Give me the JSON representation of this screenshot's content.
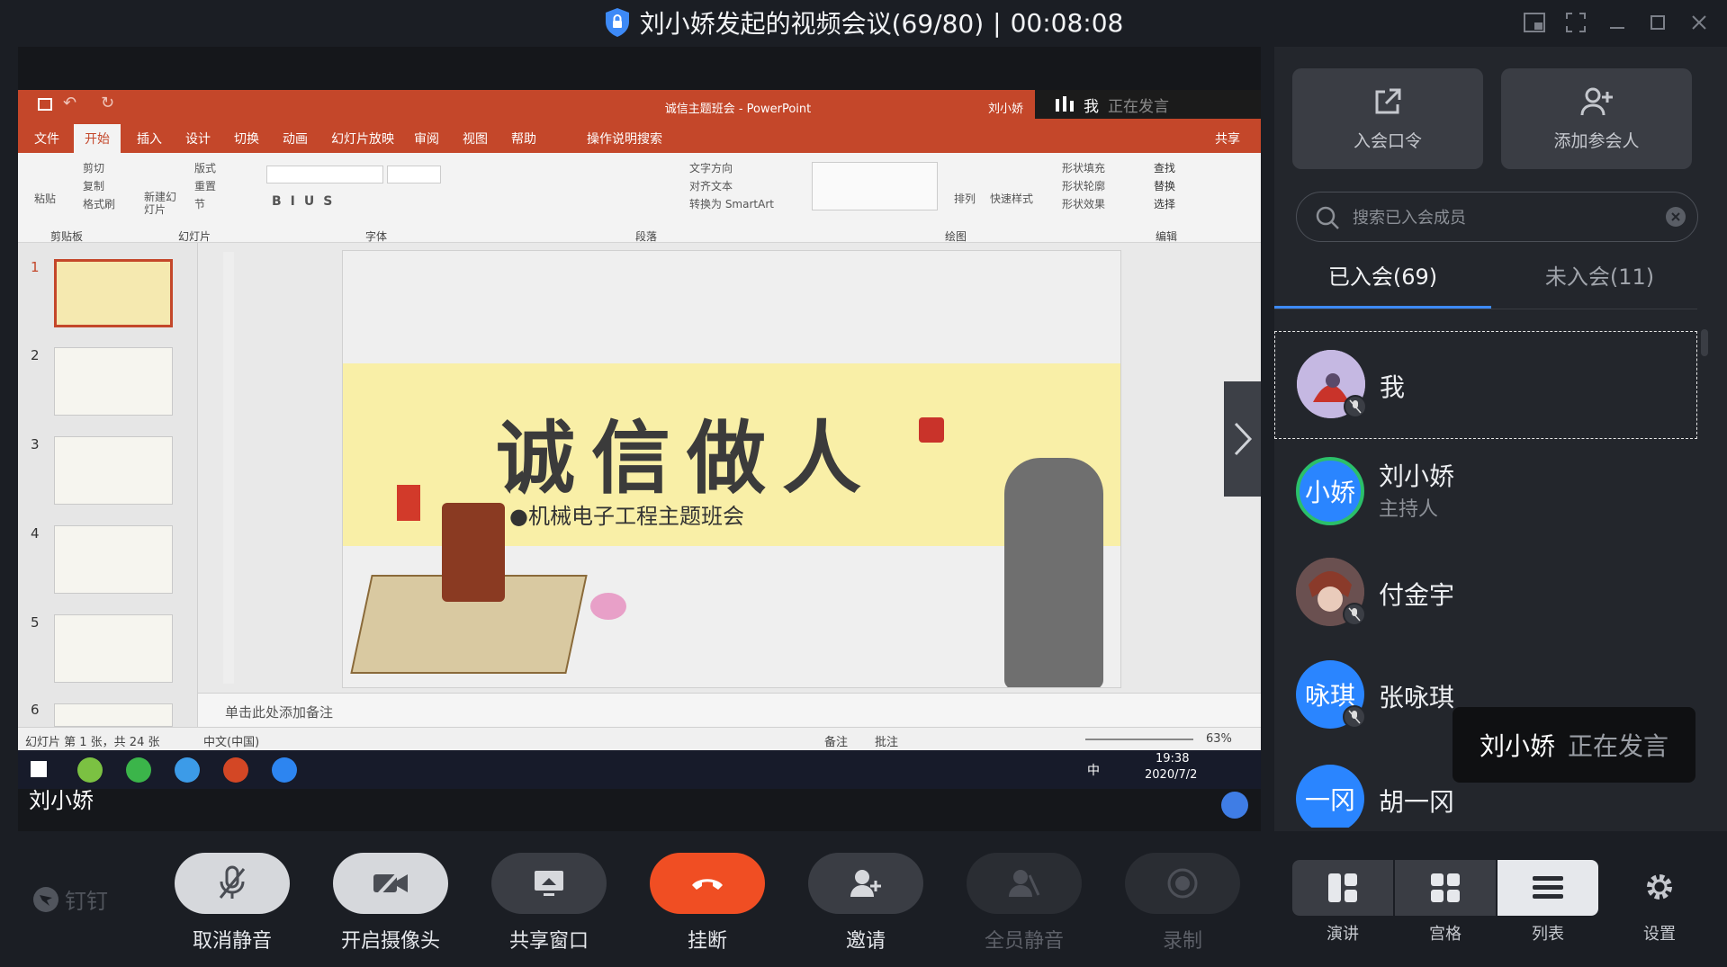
{
  "window": {
    "title": "刘小娇发起的视频会议(69/80)",
    "separator": "|",
    "duration": "00:08:08"
  },
  "shared_screen": {
    "ppt_title": "诚信主题班会 - PowerPoint",
    "ppt_user": "刘小娇",
    "ribbon_tabs": [
      "文件",
      "开始",
      "插入",
      "设计",
      "切换",
      "动画",
      "幻灯片放映",
      "审阅",
      "视图",
      "帮助",
      "操作说明搜索"
    ],
    "share_label": "共享",
    "ribbon_groups": [
      "剪贴板",
      "幻灯片",
      "字体",
      "段落",
      "绘图",
      "编辑"
    ],
    "ribbon_buttons": [
      "粘贴",
      "剪切",
      "复制",
      "格式刷",
      "新建幻灯片",
      "版式",
      "重置",
      "节",
      "文字方向",
      "对齐文本",
      "转换为 SmartArt",
      "排列",
      "快速样式",
      "形状填充",
      "形状轮廓",
      "形状效果",
      "查找",
      "替换",
      "选择"
    ],
    "slide_numbers": [
      "1",
      "2",
      "3",
      "4",
      "5",
      "6"
    ],
    "slide_title": "诚信做人",
    "slide_subtitle": "●机械电子工程主题班会",
    "notes_placeholder": "单击此处添加备注",
    "status_left": "幻灯片 第 1 张，共 24 张",
    "status_lang": "中文(中国)",
    "status_notes": "备注",
    "status_comments": "批注",
    "zoom": "63%",
    "taskbar_time": "19:38",
    "taskbar_date": "2020/7/2",
    "taskbar_ime": "中",
    "speaking_me": "我",
    "speaking_text": "正在发言"
  },
  "stage_name": "刘小娇",
  "side": {
    "join_code_label": "入会口令",
    "add_member_label": "添加参会人",
    "search_placeholder": "搜索已入会成员",
    "tab_joined": "已入会(69)",
    "tab_not_joined": "未入会(11)",
    "members": [
      {
        "name": "我",
        "role": "",
        "avatar_text": "",
        "avatar_color": "#b9a8d9",
        "muted": true
      },
      {
        "name": "刘小娇",
        "role": "主持人",
        "avatar_text": "小娇",
        "avatar_color": "#2a85ff",
        "muted": false
      },
      {
        "name": "付金宇",
        "role": "",
        "avatar_text": "",
        "avatar_color": "#5b4a4a",
        "muted": true
      },
      {
        "name": "张咏琪",
        "role": "",
        "avatar_text": "咏琪",
        "avatar_color": "#2a85ff",
        "muted": true
      },
      {
        "name": "胡一冈",
        "role": "",
        "avatar_text": "一冈",
        "avatar_color": "#2a85ff",
        "muted": false
      }
    ],
    "speaker_toast_name": "刘小娇",
    "speaker_toast_text": "正在发言"
  },
  "toolbar": {
    "brand": "钉钉",
    "controls": [
      {
        "label": "取消静音",
        "icon": "mic-off-icon"
      },
      {
        "label": "开启摄像头",
        "icon": "camera-off-icon"
      },
      {
        "label": "共享窗口",
        "icon": "share-window-icon"
      },
      {
        "label": "挂断",
        "icon": "hangup-icon"
      },
      {
        "label": "邀请",
        "icon": "invite-icon"
      },
      {
        "label": "全员静音",
        "icon": "mute-all-icon"
      },
      {
        "label": "录制",
        "icon": "record-icon"
      }
    ],
    "views": [
      {
        "label": "演讲",
        "icon": "speaker-view-icon"
      },
      {
        "label": "宫格",
        "icon": "grid-view-icon"
      },
      {
        "label": "列表",
        "icon": "list-view-icon"
      }
    ],
    "settings_label": "设置"
  },
  "colors": {
    "accent": "#3d8af7",
    "hangup": "#f04e23",
    "ppt_red": "#c4472a",
    "background": "#1b1e24"
  }
}
